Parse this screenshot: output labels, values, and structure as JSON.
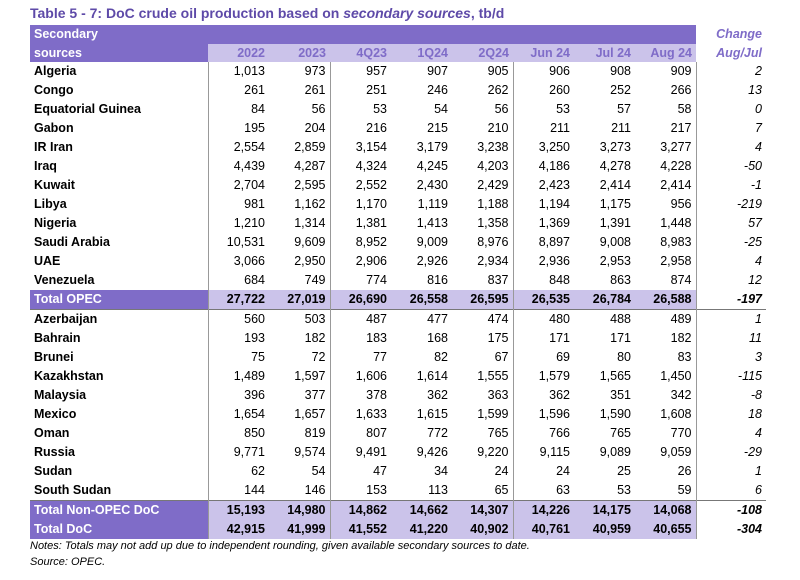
{
  "title": {
    "prefix": "Table 5 - 7: DoC crude oil production based on ",
    "italic": "secondary sources",
    "suffix": ", tb/d"
  },
  "header": {
    "source_label_1": "Secondary",
    "source_label_2": "sources",
    "columns": [
      "2022",
      "2023",
      "4Q23",
      "1Q24",
      "2Q24",
      "Jun 24",
      "Jul 24",
      "Aug 24"
    ],
    "change_label_1": "Change",
    "change_label_2": "Aug/Jul"
  },
  "opec_rows": [
    {
      "name": "Algeria",
      "values": [
        "1,013",
        "973",
        "957",
        "907",
        "905",
        "906",
        "908",
        "909"
      ],
      "change": "2"
    },
    {
      "name": "Congo",
      "values": [
        "261",
        "261",
        "251",
        "246",
        "262",
        "260",
        "252",
        "266"
      ],
      "change": "13"
    },
    {
      "name": "Equatorial Guinea",
      "values": [
        "84",
        "56",
        "53",
        "54",
        "56",
        "53",
        "57",
        "58"
      ],
      "change": "0"
    },
    {
      "name": "Gabon",
      "values": [
        "195",
        "204",
        "216",
        "215",
        "210",
        "211",
        "211",
        "217"
      ],
      "change": "7"
    },
    {
      "name": "IR Iran",
      "values": [
        "2,554",
        "2,859",
        "3,154",
        "3,179",
        "3,238",
        "3,250",
        "3,273",
        "3,277"
      ],
      "change": "4"
    },
    {
      "name": "Iraq",
      "values": [
        "4,439",
        "4,287",
        "4,324",
        "4,245",
        "4,203",
        "4,186",
        "4,278",
        "4,228"
      ],
      "change": "-50"
    },
    {
      "name": "Kuwait",
      "values": [
        "2,704",
        "2,595",
        "2,552",
        "2,430",
        "2,429",
        "2,423",
        "2,414",
        "2,414"
      ],
      "change": "-1"
    },
    {
      "name": "Libya",
      "values": [
        "981",
        "1,162",
        "1,170",
        "1,119",
        "1,188",
        "1,194",
        "1,175",
        "956"
      ],
      "change": "-219"
    },
    {
      "name": "Nigeria",
      "values": [
        "1,210",
        "1,314",
        "1,381",
        "1,413",
        "1,358",
        "1,369",
        "1,391",
        "1,448"
      ],
      "change": "57"
    },
    {
      "name": "Saudi Arabia",
      "values": [
        "10,531",
        "9,609",
        "8,952",
        "9,009",
        "8,976",
        "8,897",
        "9,008",
        "8,983"
      ],
      "change": "-25"
    },
    {
      "name": "UAE",
      "values": [
        "3,066",
        "2,950",
        "2,906",
        "2,926",
        "2,934",
        "2,936",
        "2,953",
        "2,958"
      ],
      "change": "4"
    },
    {
      "name": "Venezuela",
      "values": [
        "684",
        "749",
        "774",
        "816",
        "837",
        "848",
        "863",
        "874"
      ],
      "change": "12"
    }
  ],
  "total_opec": {
    "name": "Total  OPEC",
    "values": [
      "27,722",
      "27,019",
      "26,690",
      "26,558",
      "26,595",
      "26,535",
      "26,784",
      "26,588"
    ],
    "change": "-197"
  },
  "non_opec_rows": [
    {
      "name": "Azerbaijan",
      "values": [
        "560",
        "503",
        "487",
        "477",
        "474",
        "480",
        "488",
        "489"
      ],
      "change": "1"
    },
    {
      "name": "Bahrain",
      "values": [
        "193",
        "182",
        "183",
        "168",
        "175",
        "171",
        "171",
        "182"
      ],
      "change": "11"
    },
    {
      "name": "Brunei",
      "values": [
        "75",
        "72",
        "77",
        "82",
        "67",
        "69",
        "80",
        "83"
      ],
      "change": "3"
    },
    {
      "name": "Kazakhstan",
      "values": [
        "1,489",
        "1,597",
        "1,606",
        "1,614",
        "1,555",
        "1,579",
        "1,565",
        "1,450"
      ],
      "change": "-115"
    },
    {
      "name": "Malaysia",
      "values": [
        "396",
        "377",
        "378",
        "362",
        "363",
        "362",
        "351",
        "342"
      ],
      "change": "-8"
    },
    {
      "name": "Mexico",
      "values": [
        "1,654",
        "1,657",
        "1,633",
        "1,615",
        "1,599",
        "1,596",
        "1,590",
        "1,608"
      ],
      "change": "18"
    },
    {
      "name": "Oman",
      "values": [
        "850",
        "819",
        "807",
        "772",
        "765",
        "766",
        "765",
        "770"
      ],
      "change": "4"
    },
    {
      "name": "Russia",
      "values": [
        "9,771",
        "9,574",
        "9,491",
        "9,426",
        "9,220",
        "9,115",
        "9,089",
        "9,059"
      ],
      "change": "-29"
    },
    {
      "name": "Sudan",
      "values": [
        "62",
        "54",
        "47",
        "34",
        "24",
        "24",
        "25",
        "26"
      ],
      "change": "1"
    },
    {
      "name": "South Sudan",
      "values": [
        "144",
        "146",
        "153",
        "113",
        "65",
        "63",
        "53",
        "59"
      ],
      "change": "6"
    }
  ],
  "total_non_opec": {
    "name": "Total Non-OPEC DoC",
    "values": [
      "15,193",
      "14,980",
      "14,862",
      "14,662",
      "14,307",
      "14,226",
      "14,175",
      "14,068"
    ],
    "change": "-108"
  },
  "total_doc": {
    "name": "Total DoC",
    "values": [
      "42,915",
      "41,999",
      "41,552",
      "41,220",
      "40,902",
      "40,761",
      "40,959",
      "40,655"
    ],
    "change": "-304"
  },
  "notes": "Notes: Totals may not add up due to independent rounding, given available secondary sources to date.",
  "source": "Source: OPEC."
}
